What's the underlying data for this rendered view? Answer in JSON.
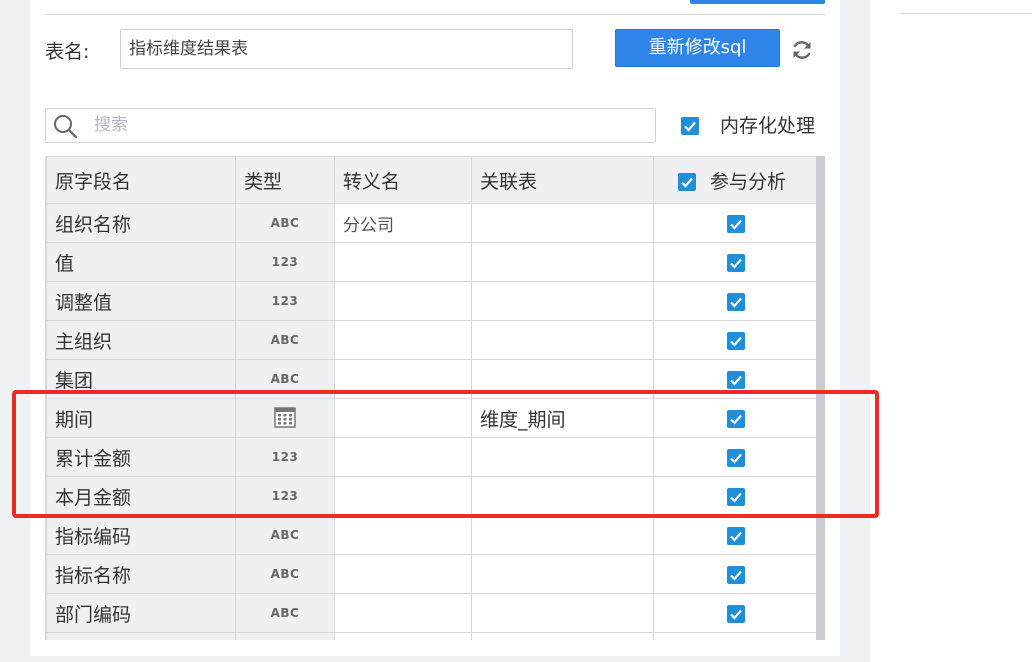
{
  "form": {
    "name_label": "表名:",
    "table_name_value": "指标维度结果表",
    "resql_button": "重新修改sql"
  },
  "search": {
    "placeholder": "搜索"
  },
  "memory_option": {
    "label": "内存化处理",
    "checked": true
  },
  "table": {
    "headers": {
      "original_field": "原字段名",
      "type": "类型",
      "alias": "转义名",
      "related_table": "关联表",
      "participate": "参与分析"
    },
    "rows": [
      {
        "field": "组织名称",
        "type": "ABC",
        "alias": "分公司",
        "related": "",
        "checked": true
      },
      {
        "field": "值",
        "type": "123",
        "alias": "",
        "related": "",
        "checked": true
      },
      {
        "field": "调整值",
        "type": "123",
        "alias": "",
        "related": "",
        "checked": true
      },
      {
        "field": "主组织",
        "type": "ABC",
        "alias": "",
        "related": "",
        "checked": true
      },
      {
        "field": "集团",
        "type": "ABC",
        "alias": "",
        "related": "",
        "checked": true
      },
      {
        "field": "期间",
        "type": "date",
        "alias": "",
        "related": "维度_期间",
        "checked": true
      },
      {
        "field": "累计金额",
        "type": "123",
        "alias": "",
        "related": "",
        "checked": true
      },
      {
        "field": "本月金额",
        "type": "123",
        "alias": "",
        "related": "",
        "checked": true
      },
      {
        "field": "指标编码",
        "type": "ABC",
        "alias": "",
        "related": "",
        "checked": true
      },
      {
        "field": "指标名称",
        "type": "ABC",
        "alias": "",
        "related": "",
        "checked": true
      },
      {
        "field": "部门编码",
        "type": "ABC",
        "alias": "",
        "related": "",
        "checked": true
      },
      {
        "field": "",
        "type": "",
        "alias": "",
        "related": "",
        "checked": false
      }
    ]
  },
  "colors": {
    "accent": "#2f86e8",
    "checkbox": "#1e8fd8",
    "highlight": "#ee2a24"
  },
  "icons": {
    "refresh": "refresh-icon",
    "search": "search-icon",
    "date_type": "calendar-icon"
  }
}
